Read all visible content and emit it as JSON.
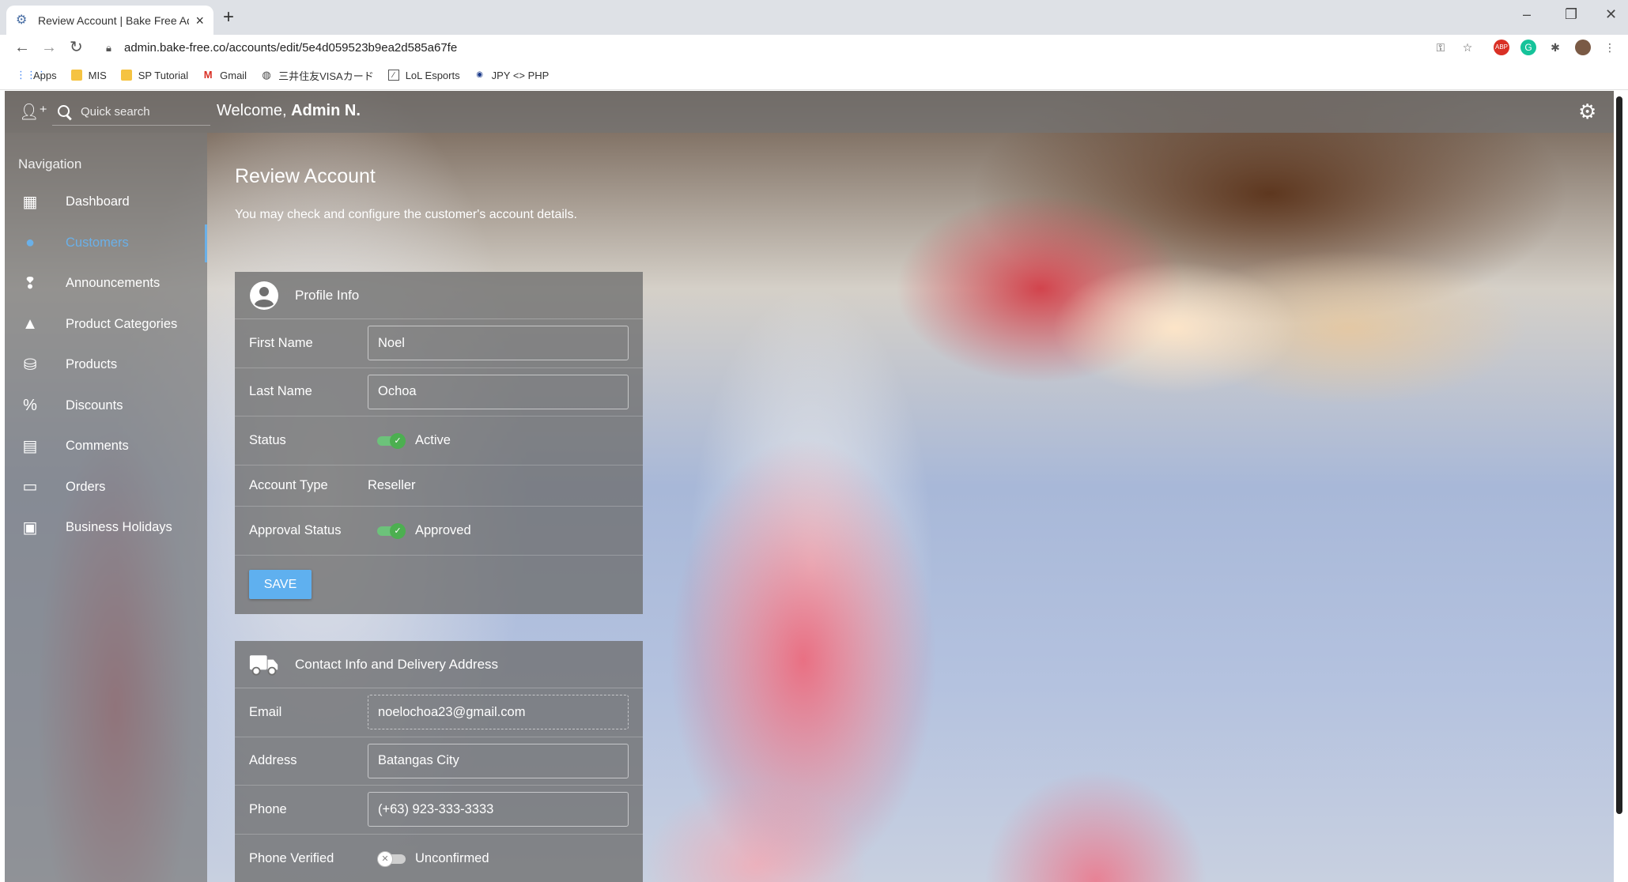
{
  "browser": {
    "tab_title": "Review Account | Bake Free Admin",
    "new_tab_label": "+",
    "url": "admin.bake-free.co/accounts/edit/5e4d059523b9ea2d585a67fe",
    "bookmarks": [
      {
        "label": "Apps",
        "icon": "apps-grid-icon"
      },
      {
        "label": "MIS",
        "icon": "folder-icon"
      },
      {
        "label": "SP Tutorial",
        "icon": "folder-icon"
      },
      {
        "label": "Gmail",
        "icon": "gmail-icon"
      },
      {
        "label": "三井住友VISAカード",
        "icon": "globe-icon"
      },
      {
        "label": "LoL Esports",
        "icon": "lol-icon"
      },
      {
        "label": "JPY <> PHP",
        "icon": "currency-icon"
      }
    ]
  },
  "topbar": {
    "search_placeholder": "Quick search",
    "welcome_prefix": "Welcome, ",
    "welcome_name": "Admin N."
  },
  "sidebar": {
    "heading": "Navigation",
    "items": [
      {
        "label": "Dashboard",
        "icon": "dashboard-icon",
        "glyph": "▦"
      },
      {
        "label": "Customers",
        "icon": "account-circle-icon",
        "glyph": "●",
        "active": true
      },
      {
        "label": "Announcements",
        "icon": "announcement-icon",
        "glyph": "❢"
      },
      {
        "label": "Product Categories",
        "icon": "shapes-icon",
        "glyph": "▲"
      },
      {
        "label": "Products",
        "icon": "cake-icon",
        "glyph": "⛁"
      },
      {
        "label": "Discounts",
        "icon": "discount-icon",
        "glyph": "%"
      },
      {
        "label": "Comments",
        "icon": "comment-icon",
        "glyph": "▤"
      },
      {
        "label": "Orders",
        "icon": "store-icon",
        "glyph": "▭"
      },
      {
        "label": "Business Holidays",
        "icon": "calendar-icon",
        "glyph": "▣"
      }
    ]
  },
  "page": {
    "title": "Review Account",
    "description": "You may check and configure the customer's account details."
  },
  "profile": {
    "header": "Profile Info",
    "first_name_label": "First Name",
    "first_name": "Noel",
    "last_name_label": "Last Name",
    "last_name": "Ochoa",
    "status_label": "Status",
    "status_value": "Active",
    "account_type_label": "Account Type",
    "account_type": "Reseller",
    "approval_label": "Approval Status",
    "approval_value": "Approved",
    "save_label": "SAVE"
  },
  "contact": {
    "header": "Contact Info and Delivery Address",
    "email_label": "Email",
    "email": "noelochoa23@gmail.com",
    "address_label": "Address",
    "address": "Batangas City",
    "phone_label": "Phone",
    "phone": "(+63) 923-333-3333",
    "phone_verified_label": "Phone Verified",
    "phone_verified_value": "Unconfirmed"
  },
  "colors": {
    "accent": "#6ab0e8",
    "save_button": "#5fb0ef",
    "toggle_on": "#4caf50"
  }
}
